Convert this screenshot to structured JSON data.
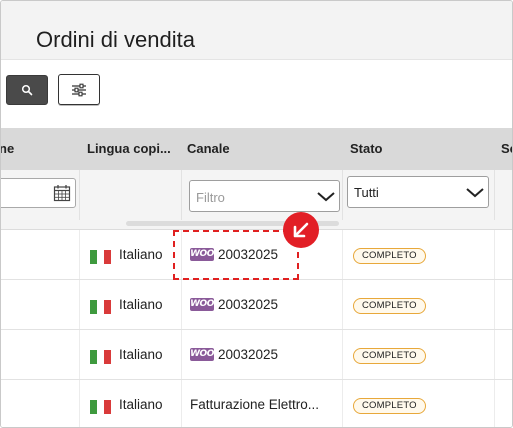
{
  "page": {
    "title": "Ordini di vendita"
  },
  "toolbar": {
    "search_icon": "search-icon",
    "filter_icon": "sliders-icon"
  },
  "table": {
    "headers": [
      "ne",
      "Lingua copi...",
      "Canale",
      "Stato",
      "Sc"
    ],
    "filters": {
      "channel_placeholder": "Filtro",
      "status_value": "Tutti"
    },
    "rows": [
      {
        "language": "Italiano",
        "channel_icon": "woocommerce-icon",
        "channel": "20032025",
        "status": "COMPLETO"
      },
      {
        "language": "Italiano",
        "channel_icon": "woocommerce-icon",
        "channel": "20032025",
        "status": "COMPLETO"
      },
      {
        "language": "Italiano",
        "channel_icon": "woocommerce-icon",
        "channel": "20032025",
        "status": "COMPLETO"
      },
      {
        "language": "Italiano",
        "channel_icon": "",
        "channel": "Fatturazione Elettro...",
        "status": "COMPLETO"
      }
    ]
  },
  "woo_logo_text": "WOO",
  "colors": {
    "accent_red": "#e21f26",
    "badge_border": "#e8a83a",
    "woo_purple": "#8a5a99",
    "flag_green": "#3e9a3e",
    "flag_red": "#d93a3a"
  }
}
